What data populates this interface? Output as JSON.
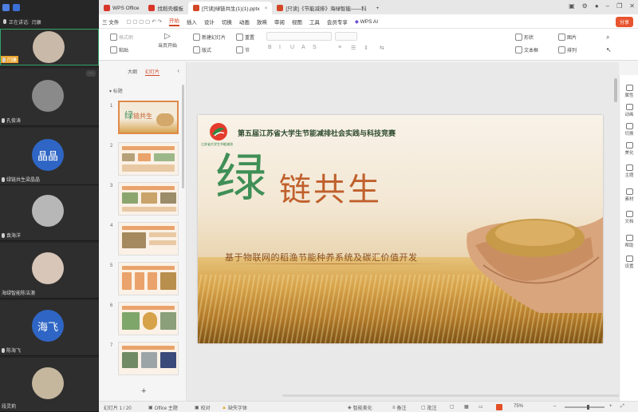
{
  "meeting": {
    "speaking_label": "正在讲话:",
    "speaking_name": "闫康",
    "participants": [
      {
        "name": "闫康",
        "avatar_text": ""
      },
      {
        "name": "孔俊涛",
        "avatar_text": ""
      },
      {
        "name": "绿链共生梁晶晶",
        "avatar_text": "晶晶"
      },
      {
        "name": "袁海洋",
        "avatar_text": ""
      },
      {
        "name": "海绿智能陈洁澳",
        "avatar_text": ""
      },
      {
        "name": "陈海飞",
        "avatar_text": "海飞"
      },
      {
        "name": "段灵莉",
        "avatar_text": ""
      }
    ],
    "more_glyph": "···"
  },
  "tabs": [
    {
      "label": "WPS Office",
      "color": "#d8362a"
    },
    {
      "label": "找稻壳模板",
      "color": "#d8362a"
    },
    {
      "label": "[只读]绿链共生(1)(1).pptx",
      "color": "#d24726",
      "active": true
    },
    {
      "label": "[只读]《节能减排》海绿智能——科",
      "color": "#d24726"
    }
  ],
  "add_tab": "+",
  "menu": {
    "file": "三 文件",
    "items": [
      "开始",
      "插入",
      "设计",
      "切换",
      "动画",
      "放映",
      "审阅",
      "视图",
      "工具",
      "会员专享"
    ],
    "ai": "WPS AI",
    "share": "分享"
  },
  "ribbon": {
    "format_painter": "格式刷",
    "paste": "粘贴",
    "play_from_current": "当页开始",
    "new_slide": "新建幻灯片",
    "layout": "版式",
    "reset": "重置",
    "section": "节",
    "shape": "形状",
    "picture": "图片",
    "textbox": "文本框",
    "arrange": "排列"
  },
  "pane": {
    "tab_outline": "大纲",
    "tab_slides": "幻灯片",
    "section": "标题",
    "slide_numbers": [
      "1",
      "2",
      "3",
      "4",
      "5",
      "6",
      "7"
    ],
    "add_glyph": "+"
  },
  "slide": {
    "competition": "第五届江苏省大学生节能减排社会实践与科技竞赛",
    "logo_caption": "江苏省大学生节能减排",
    "title_big": "绿",
    "title_rest": "链共生",
    "subtitle": "基于物联网的稻渔节能种养系统及碳汇价值开发"
  },
  "right_rail": [
    "属性",
    "动画",
    "切换",
    "美化",
    "主题",
    "素材",
    "文档",
    "帮助",
    "设置"
  ],
  "status": {
    "slide_pos": "幻灯片 1 / 20",
    "theme": "Office 主题",
    "proof": "校对",
    "missing_font": "缺失字体",
    "beautify": "智能美化",
    "notes": "备注",
    "comments": "批注",
    "zoom": "75%"
  }
}
